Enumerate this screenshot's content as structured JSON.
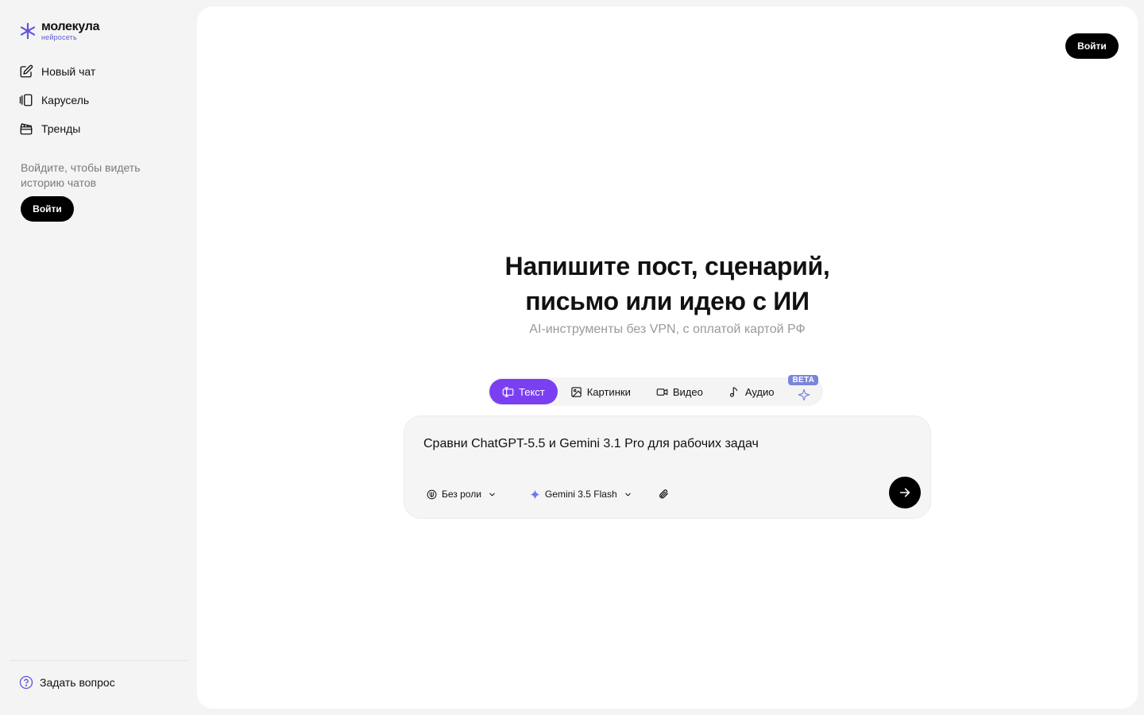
{
  "brand": {
    "name": "молекула",
    "tagline": "нейросеть",
    "accent": "#5b5bd6"
  },
  "sidebar": {
    "items": [
      {
        "label": "Новый чат",
        "icon": "edit-icon"
      },
      {
        "label": "Карусель",
        "icon": "carousel-icon"
      },
      {
        "label": "Тренды",
        "icon": "clapperboard-icon"
      }
    ],
    "login_hint": "Войдите, чтобы видеть историю чатов",
    "login_label": "Войти",
    "help_label": "Задать вопрос"
  },
  "header": {
    "login_label": "Войти"
  },
  "hero": {
    "title_line1": "Напишите пост, сценарий,",
    "title_line2": "письмо или идею с ИИ",
    "subtitle": "AI-инструменты без VPN, с оплатой картой РФ"
  },
  "modes": {
    "active_color": "#7b3ff2",
    "tabs": [
      {
        "label": "Текст",
        "icon": "text-icon",
        "active": true
      },
      {
        "label": "Картинки",
        "icon": "image-icon",
        "active": false
      },
      {
        "label": "Видео",
        "icon": "video-icon",
        "active": false
      },
      {
        "label": "Аудио",
        "icon": "music-note-icon",
        "active": false
      }
    ],
    "beta_badge": "BETA"
  },
  "composer": {
    "prompt_value": "Сравни ChatGPT-5.5 и Gemini 3.1 Pro для рабочих задач",
    "role_label": "Без роли",
    "model_label": "Gemini 3.5 Flash"
  }
}
